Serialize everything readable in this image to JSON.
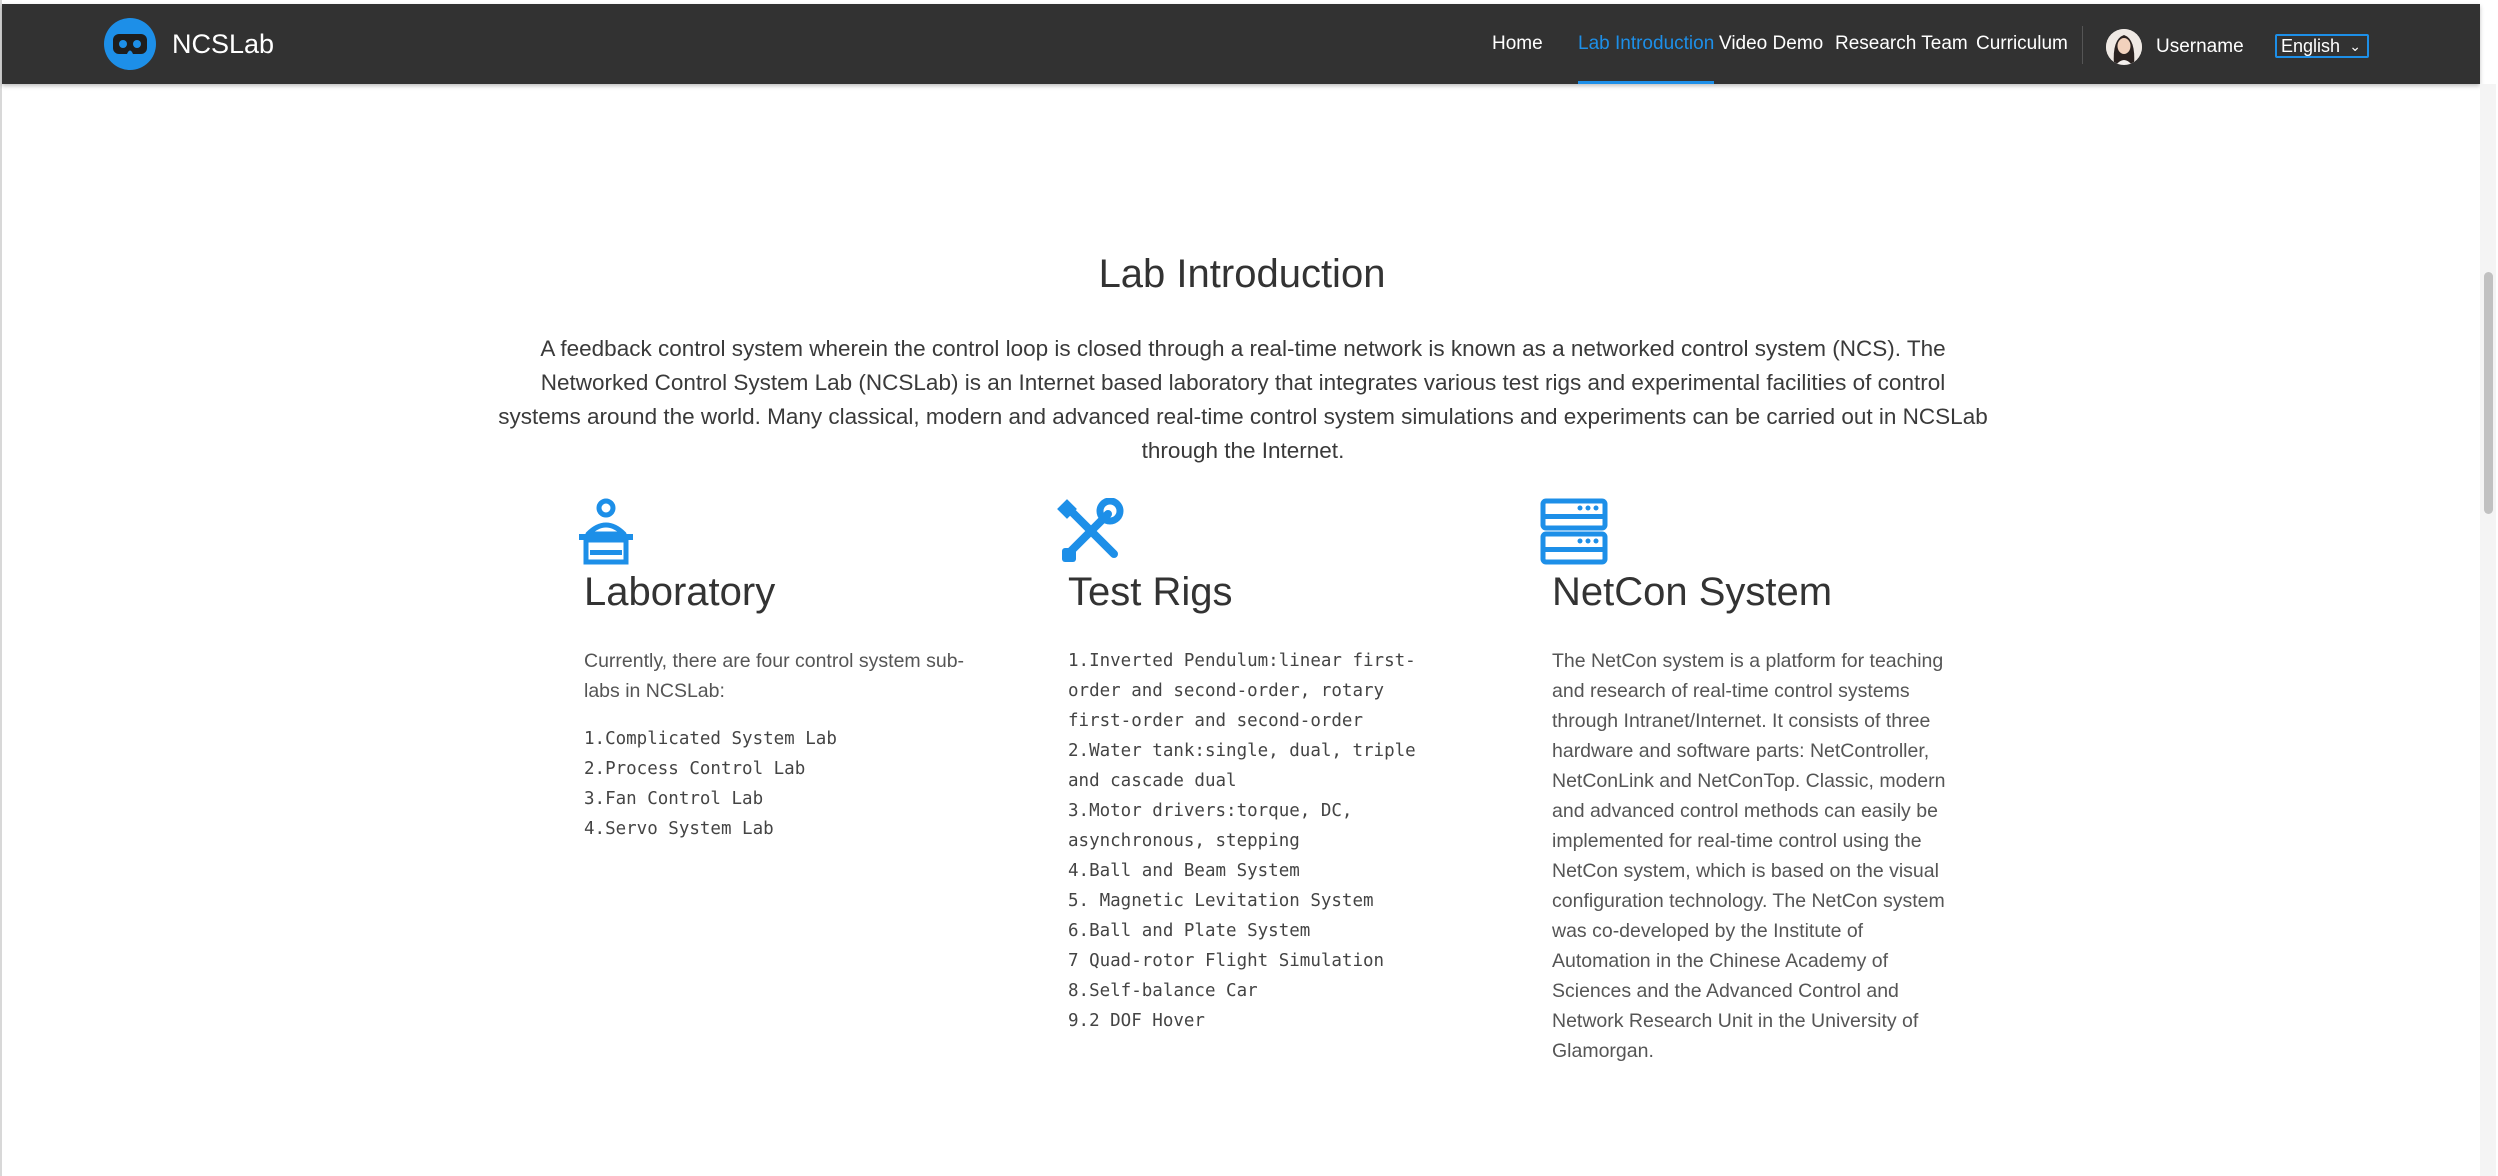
{
  "header": {
    "brand_name": "NCSLab",
    "nav": [
      {
        "label": "Home",
        "active": false
      },
      {
        "label": "Lab Introduction",
        "active": true
      },
      {
        "label": "Video Demo",
        "active": false
      },
      {
        "label": "Research Team",
        "active": false
      },
      {
        "label": "Curriculum",
        "active": false
      }
    ],
    "username": "Username",
    "language": "English"
  },
  "colors": {
    "accent": "#1d8fe8",
    "navbar": "#323232"
  },
  "main": {
    "title": "Lab Introduction",
    "intro": "A feedback control system wherein the control loop is closed through a real-time network is known as a networked control system (NCS). The Networked Control System Lab (NCSLab) is an Internet based laboratory that integrates various test rigs and experimental facilities of control systems around the world. Many classical, modern and advanced real-time control system simulations and experiments can be carried out in NCSLab through the Internet.",
    "columns": [
      {
        "icon": "laboratory-icon",
        "heading": "Laboratory",
        "description": "Currently, there are four control system sub-labs in NCSLab:",
        "items": [
          "1.Complicated System Lab",
          "2.Process Control Lab",
          "3.Fan Control Lab",
          "4.Servo System Lab"
        ]
      },
      {
        "icon": "tools-icon",
        "heading": "Test Rigs",
        "items": [
          "1.Inverted Pendulum:linear first-order and second-order, rotary first-order and second-order",
          "2.Water tank:single, dual, triple and cascade dual",
          "3.Motor drivers:torque, DC, asynchronous, stepping",
          "4.Ball and Beam System",
          "5. Magnetic Levitation System",
          "6.Ball and Plate System",
          "7 Quad-rotor Flight Simulation",
          "8.Self-balance Car",
          "9.2 DOF Hover"
        ]
      },
      {
        "icon": "server-icon",
        "heading": "NetCon System",
        "description": "The NetCon system is a platform for teaching and research of real-time control systems through Intranet/Internet. It consists of three hardware and software parts: NetController, NetConLink and NetConTop. Classic, modern and advanced control methods can easily be implemented for real-time control using the NetCon system, which is based on the visual configuration technology. The NetCon system was co-developed by the Institute of Automation in the Chinese Academy of Sciences and the Advanced Control and Network Research Unit in the University of Glamorgan."
      }
    ]
  }
}
